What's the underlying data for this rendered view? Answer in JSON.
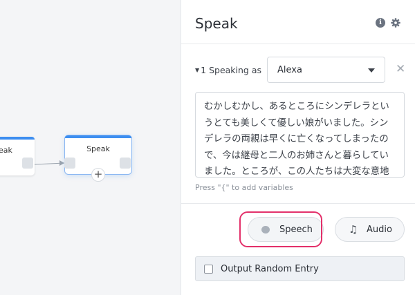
{
  "canvas": {
    "nodes": [
      {
        "title": "eak"
      },
      {
        "title": "Speak"
      }
    ]
  },
  "panel": {
    "title": "Speak",
    "speaking": {
      "label": "1 Speaking as",
      "voice": "Alexa"
    },
    "text": "むかしむかし、あるところにシンデレラというとても美しくて優しい娘がいました。シンデレラの両親は早くに亡くなってしまったので、今は継母と二人のお姉さんと暮らしていました。ところが、この人たちは大変な意地悪で、",
    "hint": "Press \"{\" to add variables",
    "buttons": {
      "speech": "Speech",
      "audio": "Audio"
    },
    "random_entry": "Output Random Entry"
  },
  "colors": {
    "accent": "#3d8ef0",
    "highlight": "#e3306a"
  }
}
